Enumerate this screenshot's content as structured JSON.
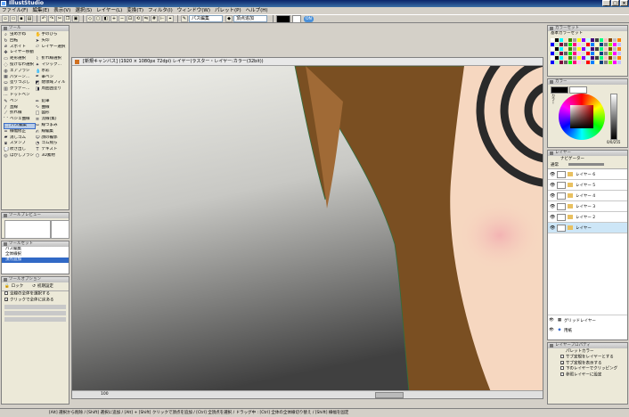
{
  "window": {
    "title": "IllustStudio"
  },
  "menu": [
    "ファイル(F)",
    "編集(E)",
    "表示(V)",
    "選択(S)",
    "レイヤー(L)",
    "変換(T)",
    "フィルタ(I)",
    "ウィンドウ(W)",
    "パレット(P)",
    "ヘルプ(H)"
  ],
  "toolbar": {
    "tool_select": "パス編集",
    "mode_select": "頂点追加",
    "tag": "ON"
  },
  "tool_panel": {
    "title": "ツール",
    "tools": [
      {
        "label": "虫めがね",
        "icon": "magnifier-icon"
      },
      {
        "label": "手のひら",
        "icon": "hand-icon"
      },
      {
        "label": "回転",
        "icon": "rotate-icon"
      },
      {
        "label": "矢印",
        "icon": "arrow-icon"
      },
      {
        "label": "スポイト",
        "icon": "eyedropper-icon"
      },
      {
        "label": "レイヤー選択",
        "icon": "layer-select-icon"
      },
      {
        "label": "レイヤー移動",
        "icon": "move-icon"
      },
      {
        "label": "",
        "icon": ""
      },
      {
        "label": "矩形選択",
        "icon": "rect-select-icon"
      },
      {
        "label": "折れ線選択",
        "icon": "polyline-select-icon"
      },
      {
        "label": "投げなわ選択",
        "icon": "lasso-icon"
      },
      {
        "label": "マジック…",
        "icon": "magic-wand-icon"
      },
      {
        "label": "エアブラシ",
        "icon": "airbrush-icon"
      },
      {
        "label": "水彩",
        "icon": "watercolor-icon"
      },
      {
        "label": "パターン…",
        "icon": "pattern-icon"
      },
      {
        "label": "筆ペン",
        "icon": "brush-pen-icon"
      },
      {
        "label": "塗りつぶし",
        "icon": "bucket-icon"
      },
      {
        "label": "閉領域フィル",
        "icon": "closed-fill-icon"
      },
      {
        "label": "グラデー…",
        "icon": "gradient-icon"
      },
      {
        "label": "周囲囲塗り",
        "icon": "surround-fill-icon"
      },
      {
        "label": "ドットペン",
        "icon": "dot-pen-icon"
      },
      {
        "label": "",
        "icon": ""
      },
      {
        "label": "ペン",
        "icon": "pen-icon"
      },
      {
        "label": "鉛筆",
        "icon": "pencil-icon"
      },
      {
        "label": "直線",
        "icon": "line-icon"
      },
      {
        "label": "曲線",
        "icon": "curve-icon"
      },
      {
        "label": "折れ線",
        "icon": "polyline-icon"
      },
      {
        "label": "図形",
        "icon": "shape-icon"
      },
      {
        "label": "ベジェ曲線",
        "icon": "bezier-icon"
      },
      {
        "label": "流線(集)",
        "icon": "speedline-icon"
      },
      {
        "label": "パス編集",
        "icon": "path-edit-icon"
      },
      {
        "label": "線つまみ",
        "icon": "line-pinch-icon"
      },
      {
        "label": "線幅修正",
        "icon": "line-width-icon"
      },
      {
        "label": "線編集",
        "icon": "line-edit-icon"
      },
      {
        "label": "消しゴム",
        "icon": "eraser-icon"
      },
      {
        "label": "顔の輪郭",
        "icon": "face-icon"
      },
      {
        "label": "スタンプ",
        "icon": "stamp-icon"
      },
      {
        "label": "ゴム飛ら",
        "icon": "rubber-icon"
      },
      {
        "label": "吹き出し",
        "icon": "balloon-icon"
      },
      {
        "label": "テキスト",
        "icon": "text-icon"
      },
      {
        "label": "ほかしブラシ",
        "icon": "blur-brush-icon"
      },
      {
        "label": "3D素材",
        "icon": "3d-icon"
      }
    ],
    "selected": 30
  },
  "tool_preview": {
    "title": "ツールプレビュー"
  },
  "tool_set": {
    "title": "ツールセット",
    "items": [
      "パス編集",
      "全体線択",
      "頂点追加"
    ],
    "selected": 2
  },
  "tool_option": {
    "title": "ツールオプション",
    "lock": "ロック",
    "init": "初期設定",
    "opt1": "全線の全体を選択する",
    "opt2": "クリックで全体に戻ある"
  },
  "canvas": {
    "title": "[新規キャンバス] (1920 × 1080px 72dpi)  レイヤー(ラスター・レイヤー:カラー(32bit))",
    "zoom": "100"
  },
  "color_set": {
    "title": "カラーセット",
    "name": "基本カラーセット"
  },
  "color_picker": {
    "title": "カラー",
    "label": "カラー",
    "readout": "0/0/255"
  },
  "layer_panel": {
    "title": "レイヤー",
    "tab": "ナビゲーター",
    "blend": "通常",
    "layers": [
      "レイヤー 6",
      "レイヤー 5",
      "レイヤー 4",
      "レイヤー 3",
      "レイヤー 2",
      "レイヤー"
    ],
    "selected": 5,
    "grid_layer": "グリッドレイヤー",
    "paper": "用紙"
  },
  "layer_prop": {
    "title": "レイヤープロパティ",
    "palette": "パレットカラー",
    "opts": [
      {
        "label": "サブ定規をレイヤーとする",
        "on": false
      },
      {
        "label": "サブ定規を表示する",
        "on": true
      },
      {
        "label": "下のレイヤーでクリッピング",
        "on": false
      },
      {
        "label": "参照レイヤーに設定",
        "on": false
      }
    ]
  },
  "status": {
    "text": "[Alt] 選択から削除 / [Shift] 選択に追加 / [Alt] + [Shift] クリックで頂点を追加 / [Ctrl] 全頂点を選択 / ドラッグ中 : [Ctrl] 全体の全体線切り替え / [Shift] 線幅を固定"
  },
  "colors": {
    "hair": "#7a4f22",
    "skin": "#f6d7c0",
    "accent": "#3169c6"
  }
}
